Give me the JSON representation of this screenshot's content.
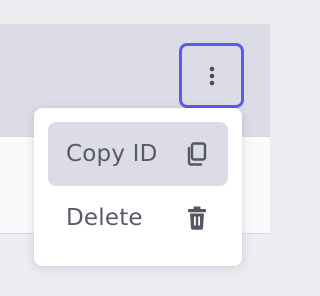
{
  "menu": {
    "items": [
      {
        "label": "Copy ID",
        "icon": "copy-icon",
        "active": true
      },
      {
        "label": "Delete",
        "icon": "trash-icon",
        "active": false
      }
    ]
  },
  "toolbar": {
    "more_icon": "kebab-vertical-icon"
  },
  "colors": {
    "accent": "#5b5ce8",
    "text": "#585a6b",
    "highlight": "#dcdce6",
    "icon": "#545661"
  }
}
